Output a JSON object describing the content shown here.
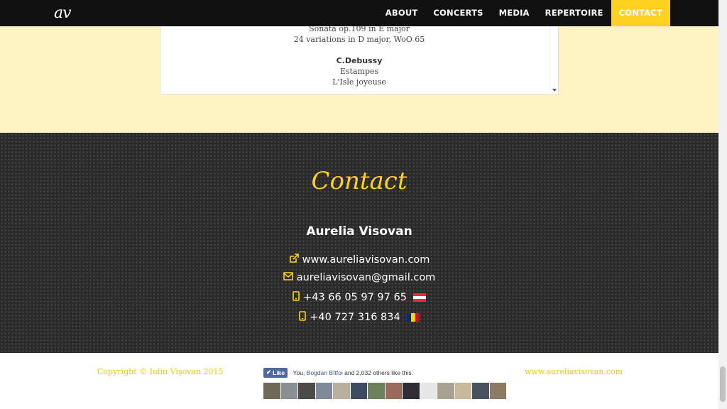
{
  "nav": {
    "logo": "av",
    "items": [
      {
        "label": "ABOUT",
        "active": false
      },
      {
        "label": "CONCERTS",
        "active": false
      },
      {
        "label": "MEDIA",
        "active": false
      },
      {
        "label": "REPERTOIRE",
        "active": false
      },
      {
        "label": "CONTACT",
        "active": true
      }
    ]
  },
  "repertoire": {
    "lines": [
      "Sonata op.109 in E major",
      "24 variations in D major, WoO 65"
    ],
    "composer": "C.Debussy",
    "works": [
      "Estampes",
      "L'Isle joyeuse"
    ]
  },
  "contact": {
    "title": "Contact",
    "name": "Aurelia Visovan",
    "website": "www.aureliavisovan.com",
    "email": "aureliavisovan@gmail.com",
    "phone_at": "+43 66 05 97 97 65",
    "phone_ro": "+40 727 316 834"
  },
  "footer": {
    "copyright": "Copyright © Iuliu Vişovan 2015",
    "like_label": "Like",
    "fb_you": "You,",
    "fb_friend": "Bogdan Bîtfoi",
    "fb_rest": "and 2,032 others like this.",
    "site_link": "www.aureliavisovan.com"
  },
  "colors": {
    "accent": "#ffd21f",
    "dark": "#111111",
    "map_bg": "#2a2a2a",
    "page_bg": "#fdf3c3"
  },
  "icons": {
    "website": "external-link-icon",
    "email": "envelope-icon",
    "phone": "mobile-phone-icon"
  }
}
